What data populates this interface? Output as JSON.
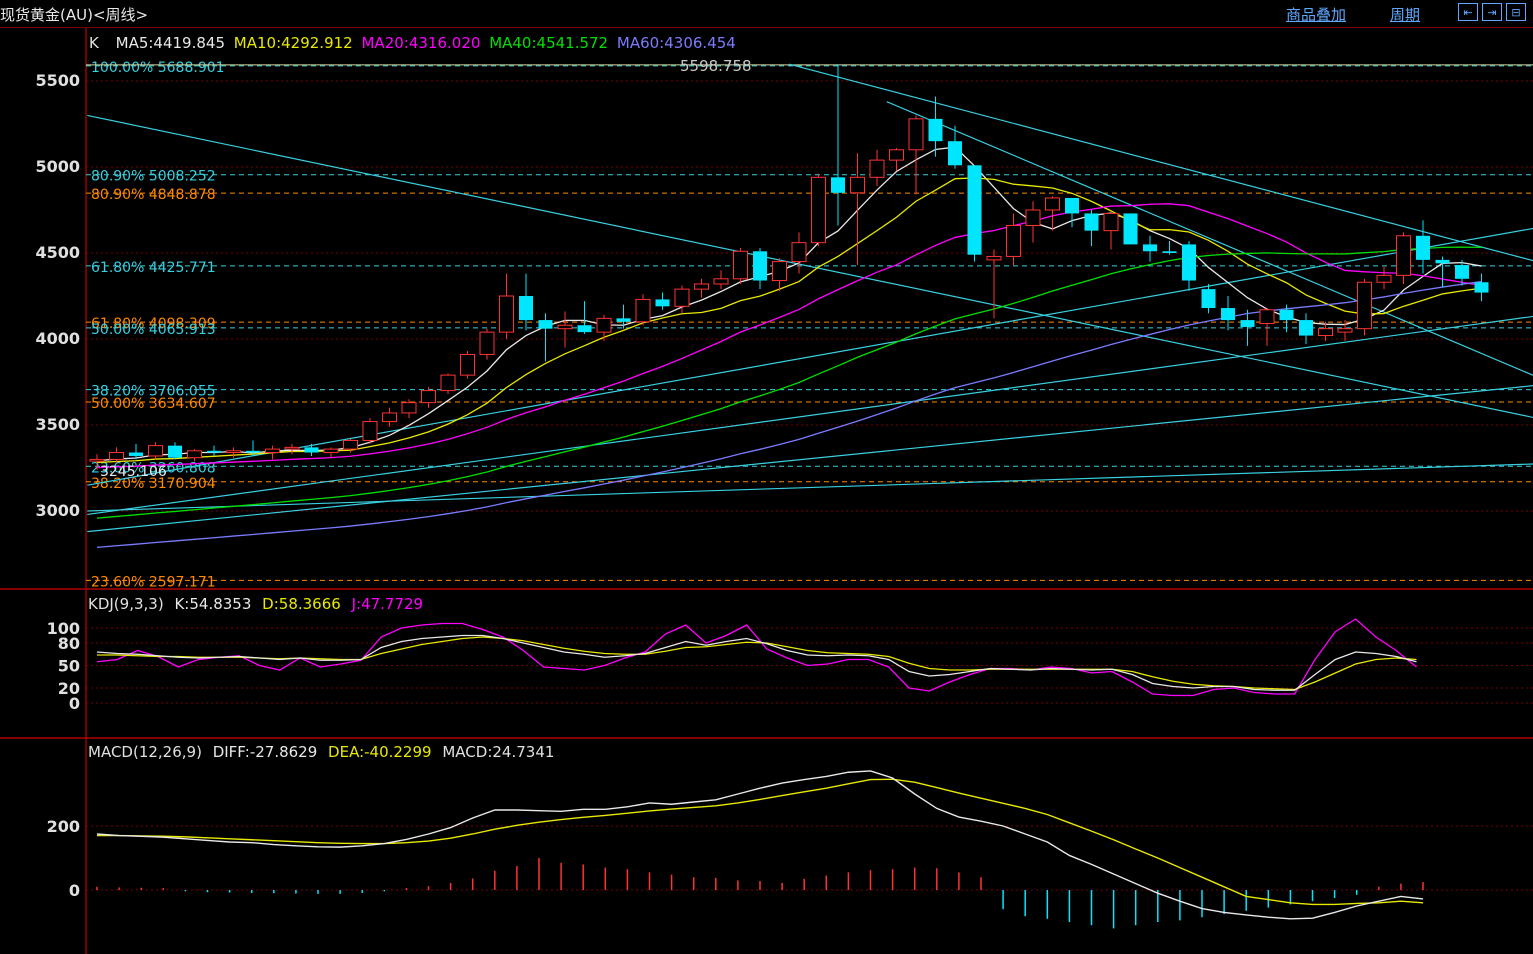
{
  "header": {
    "title": "现货黄金(AU)<周线>",
    "overlay_label": "商品叠加",
    "period_label": "周期",
    "nav_buttons": [
      "⇤",
      "⇥",
      "⊟"
    ]
  },
  "colors": {
    "up": "#ff3232",
    "down": "#00e6ff",
    "grid": "#7a0000",
    "ma5": "#e8e8e8",
    "ma10": "#e8e800",
    "ma20": "#ff00ff",
    "ma40": "#00e000",
    "ma60": "#7b7bff",
    "fib_cyan": "#38d0e0",
    "fib_orange": "#ff8a00"
  },
  "main_panel": {
    "indicator_prefix": "K",
    "ma_labels": [
      {
        "text": "MA5:4419.845",
        "key": "ma5"
      },
      {
        "text": "MA10:4292.912",
        "key": "ma10"
      },
      {
        "text": "MA20:4316.020",
        "key": "ma20"
      },
      {
        "text": "MA40:4541.572",
        "key": "ma40"
      },
      {
        "text": "MA60:4306.454",
        "key": "ma60"
      }
    ],
    "y_ticks": [
      "5500",
      "5000",
      "4500",
      "4000",
      "3500",
      "3000"
    ],
    "high_marker": "5598.758",
    "low_marker": "3245.106",
    "fib_levels": [
      {
        "label": "100.00% 5688.901",
        "value": 5588,
        "color": "cyan"
      },
      {
        "label": "80.90% 5008.252",
        "value": 4955,
        "color": "cyan"
      },
      {
        "label": "80.90% 4848.878",
        "value": 4848,
        "color": "orange"
      },
      {
        "label": "61.80% 4425.771",
        "value": 4425,
        "color": "cyan"
      },
      {
        "label": "61.80% 4098.309",
        "value": 4098,
        "color": "orange"
      },
      {
        "label": "50.00% 4065.913",
        "value": 4065,
        "color": "cyan"
      },
      {
        "label": "38.20% 3706.055",
        "value": 3706,
        "color": "cyan"
      },
      {
        "label": "50.00% 3634.607",
        "value": 3634,
        "color": "orange"
      },
      {
        "label": "23.60% 3260.808",
        "value": 3260,
        "color": "cyan"
      },
      {
        "label": "38.20% 3170.904",
        "value": 3170,
        "color": "orange"
      },
      {
        "label": "23.60% 2597.171",
        "value": 2597,
        "color": "orange"
      }
    ]
  },
  "kdj_panel": {
    "labels": [
      {
        "text": "KDJ(9,3,3)",
        "key": "label"
      },
      {
        "text": "K:54.8353",
        "key": "k"
      },
      {
        "text": "D:58.3666",
        "key": "d"
      },
      {
        "text": "J:47.7729",
        "key": "j"
      }
    ],
    "y_ticks": [
      "100",
      "80",
      "50",
      "20",
      "0"
    ]
  },
  "macd_panel": {
    "labels": [
      {
        "text": "MACD(12,26,9)",
        "key": "label"
      },
      {
        "text": "DIFF:-27.8629",
        "key": "diff"
      },
      {
        "text": "DEA:-40.2299",
        "key": "dea"
      },
      {
        "text": "MACD:24.7341",
        "key": "macd"
      }
    ],
    "y_ticks": [
      "200",
      "0"
    ]
  },
  "chart_data": {
    "type": "candlestick",
    "title": "现货黄金(AU)<周线>",
    "ylim": [
      2600,
      5700
    ],
    "candles": [
      {
        "o": 3290,
        "h": 3330,
        "l": 3240,
        "c": 3300
      },
      {
        "o": 3300,
        "h": 3370,
        "l": 3280,
        "c": 3340
      },
      {
        "o": 3340,
        "h": 3390,
        "l": 3300,
        "c": 3320
      },
      {
        "o": 3320,
        "h": 3400,
        "l": 3300,
        "c": 3380
      },
      {
        "o": 3380,
        "h": 3400,
        "l": 3300,
        "c": 3310
      },
      {
        "o": 3310,
        "h": 3360,
        "l": 3290,
        "c": 3350
      },
      {
        "o": 3350,
        "h": 3380,
        "l": 3320,
        "c": 3340
      },
      {
        "o": 3340,
        "h": 3370,
        "l": 3310,
        "c": 3350
      },
      {
        "o": 3350,
        "h": 3410,
        "l": 3320,
        "c": 3340
      },
      {
        "o": 3340,
        "h": 3380,
        "l": 3300,
        "c": 3360
      },
      {
        "o": 3360,
        "h": 3390,
        "l": 3330,
        "c": 3370
      },
      {
        "o": 3370,
        "h": 3390,
        "l": 3320,
        "c": 3340
      },
      {
        "o": 3340,
        "h": 3370,
        "l": 3310,
        "c": 3360
      },
      {
        "o": 3360,
        "h": 3420,
        "l": 3340,
        "c": 3410
      },
      {
        "o": 3410,
        "h": 3540,
        "l": 3390,
        "c": 3520
      },
      {
        "o": 3520,
        "h": 3600,
        "l": 3490,
        "c": 3570
      },
      {
        "o": 3570,
        "h": 3650,
        "l": 3540,
        "c": 3630
      },
      {
        "o": 3630,
        "h": 3720,
        "l": 3600,
        "c": 3700
      },
      {
        "o": 3700,
        "h": 3800,
        "l": 3680,
        "c": 3790
      },
      {
        "o": 3790,
        "h": 3930,
        "l": 3770,
        "c": 3910
      },
      {
        "o": 3910,
        "h": 4060,
        "l": 3880,
        "c": 4040
      },
      {
        "o": 4040,
        "h": 4380,
        "l": 4000,
        "c": 4250
      },
      {
        "o": 4250,
        "h": 4380,
        "l": 4050,
        "c": 4110
      },
      {
        "o": 4110,
        "h": 4150,
        "l": 3870,
        "c": 4060
      },
      {
        "o": 4060,
        "h": 4160,
        "l": 3950,
        "c": 4080
      },
      {
        "o": 4080,
        "h": 4220,
        "l": 4030,
        "c": 4040
      },
      {
        "o": 4040,
        "h": 4140,
        "l": 3990,
        "c": 4120
      },
      {
        "o": 4120,
        "h": 4200,
        "l": 4060,
        "c": 4100
      },
      {
        "o": 4100,
        "h": 4260,
        "l": 4080,
        "c": 4230
      },
      {
        "o": 4230,
        "h": 4270,
        "l": 4170,
        "c": 4190
      },
      {
        "o": 4190,
        "h": 4310,
        "l": 4150,
        "c": 4290
      },
      {
        "o": 4290,
        "h": 4350,
        "l": 4240,
        "c": 4320
      },
      {
        "o": 4320,
        "h": 4400,
        "l": 4290,
        "c": 4350
      },
      {
        "o": 4350,
        "h": 4530,
        "l": 4320,
        "c": 4510
      },
      {
        "o": 4510,
        "h": 4530,
        "l": 4290,
        "c": 4340
      },
      {
        "o": 4340,
        "h": 4470,
        "l": 4280,
        "c": 4450
      },
      {
        "o": 4450,
        "h": 4620,
        "l": 4380,
        "c": 4560
      },
      {
        "o": 4560,
        "h": 4960,
        "l": 4540,
        "c": 4940
      },
      {
        "o": 4940,
        "h": 5598,
        "l": 4660,
        "c": 4850
      },
      {
        "o": 4850,
        "h": 5080,
        "l": 4430,
        "c": 4940
      },
      {
        "o": 4940,
        "h": 5100,
        "l": 4890,
        "c": 5040
      },
      {
        "o": 5040,
        "h": 5110,
        "l": 4980,
        "c": 5100
      },
      {
        "o": 5100,
        "h": 5300,
        "l": 4840,
        "c": 5280
      },
      {
        "o": 5280,
        "h": 5410,
        "l": 5060,
        "c": 5150
      },
      {
        "o": 5150,
        "h": 5240,
        "l": 4990,
        "c": 5010
      },
      {
        "o": 5010,
        "h": 5000,
        "l": 4450,
        "c": 4490
      },
      {
        "o": 4460,
        "h": 4520,
        "l": 4120,
        "c": 4480
      },
      {
        "o": 4480,
        "h": 4730,
        "l": 4430,
        "c": 4660
      },
      {
        "o": 4660,
        "h": 4800,
        "l": 4560,
        "c": 4750
      },
      {
        "o": 4750,
        "h": 4830,
        "l": 4630,
        "c": 4820
      },
      {
        "o": 4820,
        "h": 4820,
        "l": 4650,
        "c": 4730
      },
      {
        "o": 4730,
        "h": 4750,
        "l": 4540,
        "c": 4630
      },
      {
        "o": 4630,
        "h": 4710,
        "l": 4520,
        "c": 4730
      },
      {
        "o": 4730,
        "h": 4730,
        "l": 4560,
        "c": 4550
      },
      {
        "o": 4550,
        "h": 4600,
        "l": 4450,
        "c": 4510
      },
      {
        "o": 4510,
        "h": 4570,
        "l": 4490,
        "c": 4500
      },
      {
        "o": 4550,
        "h": 4570,
        "l": 4280,
        "c": 4340
      },
      {
        "o": 4290,
        "h": 4320,
        "l": 4150,
        "c": 4180
      },
      {
        "o": 4180,
        "h": 4250,
        "l": 4050,
        "c": 4110
      },
      {
        "o": 4110,
        "h": 4170,
        "l": 3960,
        "c": 4070
      },
      {
        "o": 4090,
        "h": 4180,
        "l": 3960,
        "c": 4170
      },
      {
        "o": 4170,
        "h": 4200,
        "l": 4040,
        "c": 4110
      },
      {
        "o": 4110,
        "h": 4150,
        "l": 3970,
        "c": 4020
      },
      {
        "o": 4020,
        "h": 4100,
        "l": 3990,
        "c": 4060
      },
      {
        "o": 4040,
        "h": 4110,
        "l": 3990,
        "c": 4060
      },
      {
        "o": 4060,
        "h": 4350,
        "l": 4020,
        "c": 4330
      },
      {
        "o": 4330,
        "h": 4420,
        "l": 4290,
        "c": 4370
      },
      {
        "o": 4370,
        "h": 4620,
        "l": 4320,
        "c": 4600
      },
      {
        "o": 4600,
        "h": 4690,
        "l": 4380,
        "c": 4460
      },
      {
        "o": 4460,
        "h": 4480,
        "l": 4300,
        "c": 4440
      },
      {
        "o": 4430,
        "h": 4460,
        "l": 4310,
        "c": 4350
      },
      {
        "o": 4330,
        "h": 4380,
        "l": 4220,
        "c": 4270
      }
    ],
    "kdj": {
      "k": [
        68,
        66,
        65,
        63,
        61,
        60,
        61,
        62,
        60,
        58,
        60,
        57,
        57,
        58,
        74,
        82,
        86,
        88,
        90,
        90,
        86,
        80,
        74,
        68,
        65,
        61,
        63,
        66,
        74,
        82,
        77,
        82,
        86,
        79,
        70,
        64,
        63,
        64,
        63,
        58,
        42,
        36,
        38,
        42,
        46,
        45,
        44,
        46,
        45,
        44,
        45,
        38,
        26,
        22,
        20,
        22,
        22,
        18,
        17,
        17,
        38,
        58,
        68,
        66,
        62,
        55
      ],
      "d": [
        64,
        64,
        63,
        62,
        62,
        61,
        61,
        61,
        60,
        59,
        60,
        59,
        58,
        58,
        66,
        72,
        78,
        82,
        86,
        88,
        86,
        83,
        78,
        73,
        69,
        66,
        65,
        65,
        69,
        74,
        75,
        78,
        81,
        80,
        75,
        70,
        67,
        66,
        65,
        62,
        53,
        46,
        44,
        44,
        45,
        45,
        45,
        45,
        45,
        45,
        45,
        42,
        35,
        29,
        25,
        23,
        22,
        20,
        19,
        18,
        28,
        40,
        52,
        58,
        60,
        58
      ],
      "j": [
        55,
        58,
        70,
        62,
        48,
        58,
        61,
        63,
        50,
        44,
        60,
        48,
        52,
        57,
        88,
        100,
        104,
        106,
        106,
        98,
        88,
        70,
        48,
        46,
        44,
        50,
        60,
        68,
        92,
        104,
        80,
        90,
        104,
        72,
        60,
        50,
        52,
        58,
        58,
        48,
        20,
        16,
        28,
        38,
        46,
        46,
        44,
        48,
        46,
        40,
        42,
        28,
        12,
        10,
        10,
        18,
        20,
        14,
        12,
        12,
        58,
        95,
        112,
        88,
        70,
        48
      ]
    },
    "macd": {
      "diff": [
        175,
        170,
        168,
        165,
        160,
        155,
        150,
        148,
        142,
        138,
        135,
        134,
        138,
        145,
        158,
        175,
        195,
        225,
        250,
        250,
        248,
        246,
        252,
        252,
        260,
        272,
        268,
        275,
        282,
        300,
        318,
        334,
        345,
        355,
        368,
        372,
        350,
        300,
        255,
        228,
        215,
        200,
        175,
        150,
        108,
        80,
        50,
        20,
        -10,
        -35,
        -58,
        -70,
        -78,
        -85,
        -90,
        -88,
        -70,
        -50,
        -35,
        -20,
        -28
      ],
      "dea": [
        170,
        170,
        169,
        168,
        166,
        163,
        160,
        157,
        154,
        151,
        148,
        146,
        145,
        145,
        148,
        153,
        162,
        175,
        190,
        202,
        212,
        220,
        227,
        233,
        240,
        247,
        253,
        258,
        263,
        272,
        283,
        295,
        307,
        318,
        332,
        345,
        346,
        337,
        320,
        303,
        287,
        271,
        255,
        236,
        210,
        184,
        157,
        128,
        100,
        70,
        40,
        10,
        -20,
        -30,
        -40,
        -45,
        -45,
        -42,
        -40,
        -35,
        -40
      ],
      "hist": [
        10,
        8,
        7,
        6,
        -4,
        -7,
        -8,
        -9,
        -10,
        -11,
        -12,
        -12,
        -9,
        -4,
        6,
        12,
        22,
        36,
        60,
        75,
        100,
        85,
        80,
        70,
        65,
        55,
        48,
        40,
        38,
        30,
        28,
        22,
        35,
        45,
        55,
        62,
        65,
        70,
        68,
        55,
        40,
        -60,
        -82,
        -90,
        -100,
        -110,
        -120,
        -110,
        -100,
        -95,
        -85,
        -75,
        -65,
        -55,
        -45,
        -35,
        -25,
        -15,
        10,
        20,
        24.7
      ]
    }
  }
}
